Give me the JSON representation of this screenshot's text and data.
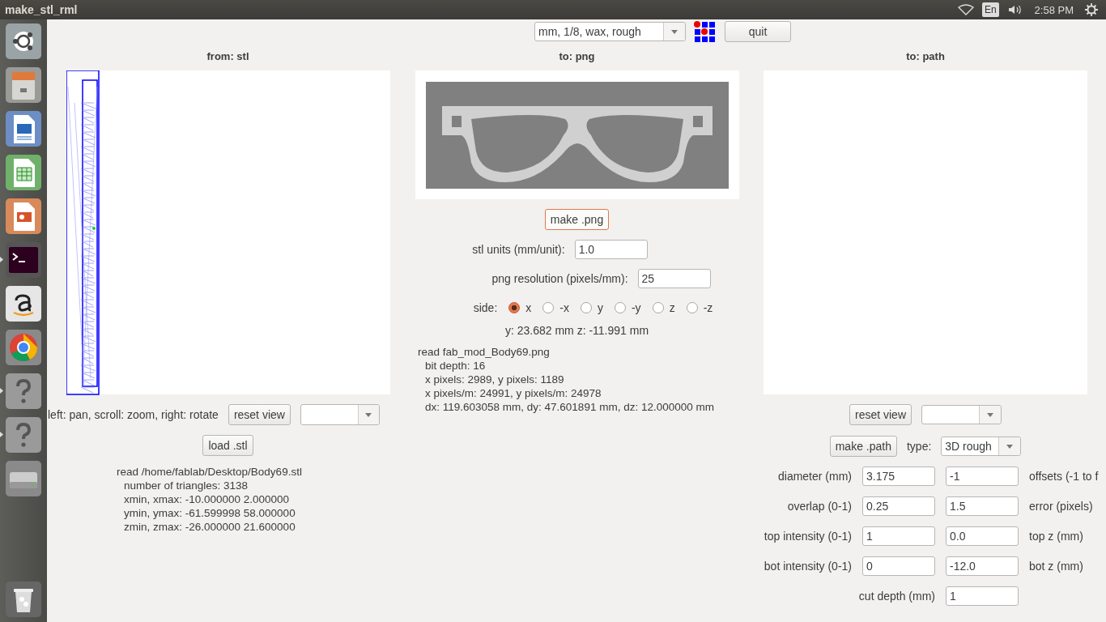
{
  "top_bar": {
    "title": "make_stl_rml",
    "keyboard": "En",
    "clock": "2:58 PM"
  },
  "launcher": [
    {
      "kind": "dash",
      "running": false
    },
    {
      "kind": "files",
      "running": false
    },
    {
      "kind": "writer",
      "running": false
    },
    {
      "kind": "calc",
      "running": false
    },
    {
      "kind": "impress",
      "running": false
    },
    {
      "kind": "terminal",
      "running": true
    },
    {
      "kind": "amazon",
      "running": false
    },
    {
      "kind": "chrome",
      "running": false
    },
    {
      "kind": "unknown",
      "running": true
    },
    {
      "kind": "unknown",
      "running": true
    },
    {
      "kind": "drive",
      "running": false
    },
    {
      "kind": "trash",
      "running": false
    }
  ],
  "toolbar": {
    "preset": "mm, 1/8, wax, rough",
    "quit": "quit"
  },
  "from_stl": {
    "heading": "from: stl",
    "hint": "left: pan, scroll: zoom, right: rotate",
    "reset_view": "reset view",
    "load": "load .stl",
    "info": {
      "title": "read /home/fablab/Desktop/Body69.stl",
      "lines": [
        "number of triangles: 3138",
        "xmin, xmax: -10.000000 2.000000",
        "ymin, ymax: -61.599998 58.000000",
        "zmin, zmax: -26.000000 21.600000"
      ]
    }
  },
  "to_png": {
    "heading": "to: png",
    "make": "make .png",
    "fields": [
      {
        "label": "stl units (mm/unit):",
        "value": "1.0"
      },
      {
        "label": "png resolution (pixels/mm):",
        "value": "25"
      }
    ],
    "side": {
      "label": "side:",
      "options": [
        {
          "label": "x",
          "selected": true
        },
        {
          "label": "-x",
          "selected": false
        },
        {
          "label": "y",
          "selected": false
        },
        {
          "label": "-y",
          "selected": false
        },
        {
          "label": "z",
          "selected": false
        },
        {
          "label": "-z",
          "selected": false
        }
      ]
    },
    "coords": "y: 23.682 mm  z: -11.991 mm",
    "info": {
      "title": "read fab_mod_Body69.png",
      "lines": [
        "bit depth: 16",
        "x pixels: 2989, y pixels: 1189",
        "x pixels/m: 24991, y pixels/m: 24978",
        "dx: 119.603058 mm, dy: 47.601891 mm, dz: 12.000000 mm"
      ]
    }
  },
  "to_path": {
    "heading": "to: path",
    "reset_view": "reset view",
    "make": "make .path",
    "type_label": "type:",
    "type": "3D rough",
    "rows": [
      {
        "label": "diameter (mm)",
        "value": "3.175",
        "value_2": "-1",
        "label_2": "offsets (-1 to f"
      },
      {
        "label": "overlap (0-1)",
        "value": "0.25",
        "value_2": "1.5",
        "label_2": "error (pixels)"
      },
      {
        "label": "top intensity (0-1)",
        "value": "1",
        "value_2": "0.0",
        "label_2": "top z (mm)"
      },
      {
        "label": "bot intensity (0-1)",
        "value": "0",
        "value_2": "-12.0",
        "label_2": "bot z (mm)"
      },
      {
        "label": "cut depth (mm)",
        "value_2": "1"
      }
    ]
  }
}
